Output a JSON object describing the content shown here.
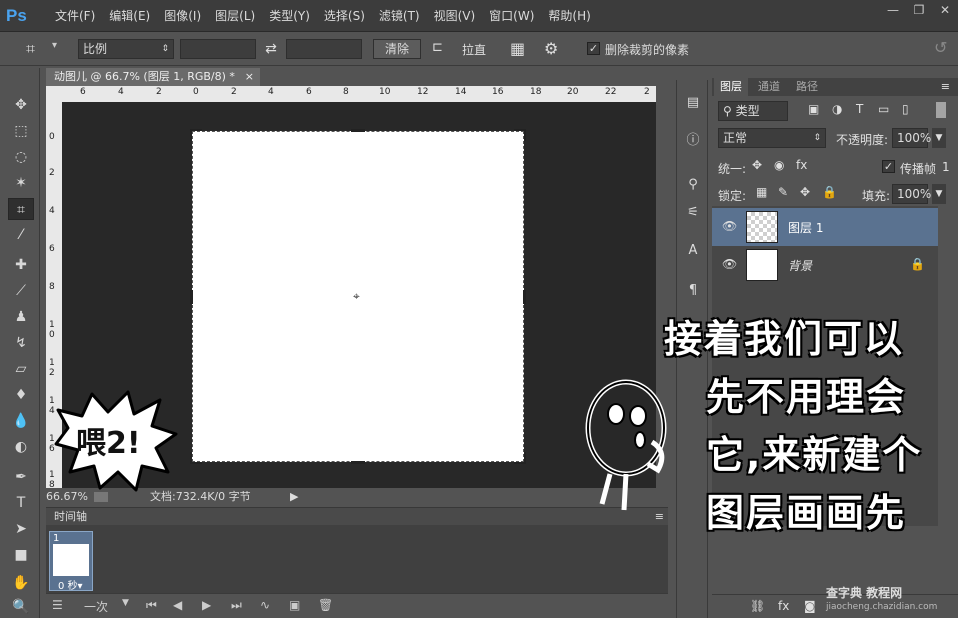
{
  "app": {
    "logo": "Ps"
  },
  "menu": [
    "文件(F)",
    "编辑(E)",
    "图像(I)",
    "图层(L)",
    "类型(Y)",
    "选择(S)",
    "滤镜(T)",
    "视图(V)",
    "窗口(W)",
    "帮助(H)"
  ],
  "window_controls": [
    "—",
    "❐",
    "✕"
  ],
  "options": {
    "ratio_select": "比例",
    "swap_icon": "⇄",
    "clear_button": "清除",
    "straighten_label": "拉直",
    "delete_cropped_label": "删除裁剪的像素",
    "delete_cropped_checked": true
  },
  "document": {
    "tab_title": "动图儿 @ 66.7% (图层 1, RGB/8) *",
    "close": "×",
    "ruler_h_labels": [
      "6",
      "4",
      "2",
      "0",
      "2",
      "4",
      "6",
      "8",
      "10",
      "12",
      "14",
      "16",
      "18",
      "20",
      "22",
      "2"
    ],
    "ruler_v_labels": [
      "0",
      "2",
      "4",
      "6",
      "8",
      "1 0",
      "1 2",
      "1 4",
      "1 6",
      "1 8"
    ],
    "zoom": "66.67%",
    "doc_info": "文档:732.4K/0 字节"
  },
  "timeline": {
    "title": "时间轴",
    "frame_number": "1",
    "frame_delay": "0 秒▾",
    "loop_option": "一次"
  },
  "layers_panel": {
    "tabs": [
      "图层",
      "通道",
      "路径"
    ],
    "filter_kind": "类型",
    "blend_mode": "正常",
    "opacity_label": "不透明度:",
    "opacity_value": "100%",
    "unify_label": "统一:",
    "propagate_label": "传播帧",
    "propagate_value": "1",
    "lock_label": "锁定:",
    "fill_label": "填充:",
    "fill_value": "100%",
    "layers": [
      {
        "name": "图层 1",
        "selected": true
      },
      {
        "name": "背景",
        "locked": true
      }
    ]
  },
  "overlay": {
    "bubble_text": "喂2!",
    "lines": [
      "接着我们可以",
      "先不用理会",
      "它,来新建个",
      "图层画画先"
    ],
    "watermark": "查字典 教程网",
    "watermark_url": "jiaocheng.chazidian.com"
  },
  "colors": {
    "accent_blue": "#4aa3ef",
    "selected_layer": "#5a7290",
    "canvas_bg": "#282828"
  }
}
